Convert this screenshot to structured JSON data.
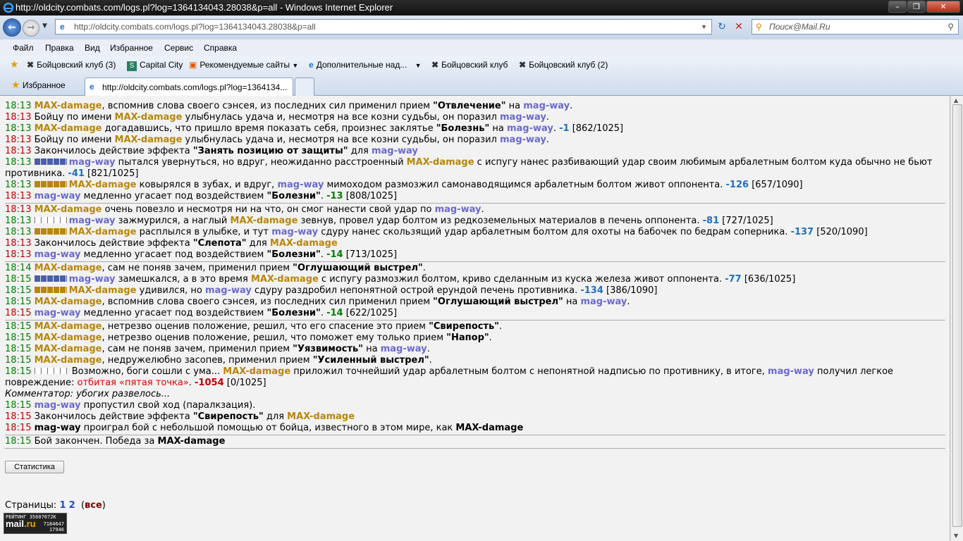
{
  "window": {
    "title": "http://oldcity.combats.com/logs.pl?log=1364134043.28038&p=all - Windows Internet Explorer"
  },
  "address": {
    "url": "http://oldcity.combats.com/logs.pl?log=1364134043.28038&p=all",
    "search_placeholder": "Поиск@Mail.Ru"
  },
  "menu": [
    "Файл",
    "Правка",
    "Вид",
    "Избранное",
    "Сервис",
    "Справка"
  ],
  "favorites": [
    "Бойцовский клуб (3)",
    "Capital City",
    "Рекомендуемые сайты",
    "Дополнительные над...",
    "Бойцовский клуб",
    "Бойцовский клуб (2)"
  ],
  "tabs": {
    "favorites_label": "Избранное",
    "active": "http://oldcity.combats.com/logs.pl?log=1364134..."
  },
  "log": {
    "time_1813": "18:13",
    "time_1814": "18:14",
    "time_1815": "18:15",
    "max": "MAX-damage",
    "mag": "mag-way",
    "l1": ", вспомнив слова своего сэнсея, из последних сил применил прием ",
    "l1q": "\"Отвлечение\"",
    "na": " на ",
    "dot": ".",
    "l2a": "Бойцу по имени ",
    "l2b": " улыбнулась удача и, несмотря на все козни судьбы, он поразил ",
    "l3": " догадавшись, что пришло время показать себя, произнес заклятье ",
    "l3q": "\"Болезнь\"",
    "l3d": "-1",
    "l3h": " [862/1025]",
    "l5a": "Закончилось действие эффекта ",
    "l5q": "\"Занять позицию от защиты\"",
    "dlya": " для ",
    "l6a": " пытался увернуться, но вдруг, неожиданно расстроенный ",
    "l6b": " с испугу нанес разбивающий удар своим любимым арбалетным болтом куда обычно не бьют противника. ",
    "l6d": "-41",
    "l6h": " [821/1025]",
    "l7a": " ковырялся в зубах, и вдруг, ",
    "l7b": " мимоходом размозжил самонаводящимся арбалетным болтом живот оппонента. ",
    "l7d": "-126",
    "l7h": " [657/1090]",
    "l8a": " медленно угасает под воздействием ",
    "l8q": "\"Болезни\"",
    "l8d": "-13",
    "l8h": " [808/1025]",
    "l9a": " очень повезло и несмотря ни на что, он смог нанести свой удар по ",
    "l10a": " зажмурился, а наглый ",
    "l10b": " зевнув, провел удар болтом из редкоземельных материалов в печень оппонента. ",
    "l10d": "-81",
    "l10h": " [727/1025]",
    "l11a": " расплылся в улыбке, и тут ",
    "l11b": " сдуру нанес скользящий удар арбалетным болтом для охоты на бабочек по бедрам соперника. ",
    "l11d": "-137",
    "l11h": " [520/1090]",
    "l12q": "\"Слепота\"",
    "l13d": "-14",
    "l13h": " [713/1025]",
    "l14a": ", сам не поняв зачем, применил прием ",
    "l14q": "\"Оглушающий выстрел\"",
    "l15a": " замешкался, а в это время ",
    "l15b": " с испугу размозжил болтом, криво сделанным из куска железа живот оппонента. ",
    "l15d": "-77",
    "l15h": " [636/1025]",
    "l16a": " удивился, но ",
    "l16b": " сдуру раздробил непонятной острой ерундой печень противника. ",
    "l16d": "-134",
    "l16h": " [386/1090]",
    "l19d": "-14",
    "l19h": " [622/1025]",
    "l20a": ", нетрезво оценив положение, решил, что его спасение это прием ",
    "l20q": "\"Свирепость\"",
    "l21a": ", нетрезво оценив положение, решил, что поможет ему только прием ",
    "l21q": "\"Напор\"",
    "l22q": "\"Уязвимость\"",
    "l23a": ", недружелюбно засопев, применил прием ",
    "l23q": "\"Усиленный выстрел\"",
    "l24a": " Возможно, боги сошли с ума... ",
    "l24b": " приложил точнейший удар арбалетным болтом с непонятной надписью по противнику, в итоге, ",
    "l24c": " получил легкое повреждение: ",
    "l24r": "отбитая «пятая точка»",
    "l24d": "-1054",
    "l24h": " [0/1025]",
    "comment": "Комментатор: убогих развелось...",
    "l26a": " пропустил свой ход (паралкзация).",
    "l28a": " проиграл бой с небольшой помощью от бойца, известного в этом мире, как ",
    "l29a": " Бой закончен. Победа за "
  },
  "stats_button": "Статистика",
  "pages": {
    "label": "Страницы: ",
    "p1": "1",
    "p2": "2",
    "all": "все"
  },
  "counter": {
    "line1": "РЕЙТИНГ 35607072K",
    "logo_a": "mail",
    "logo_b": ".ru",
    "n2": "7184647",
    "n3": "17946"
  },
  "colors": {
    "fighter_max": "#b8860b",
    "fighter_mag": "#6a6acd",
    "damage": "#1f6fbf",
    "heal": "#008000",
    "time_green": "#008000",
    "time_red": "#c00000"
  }
}
